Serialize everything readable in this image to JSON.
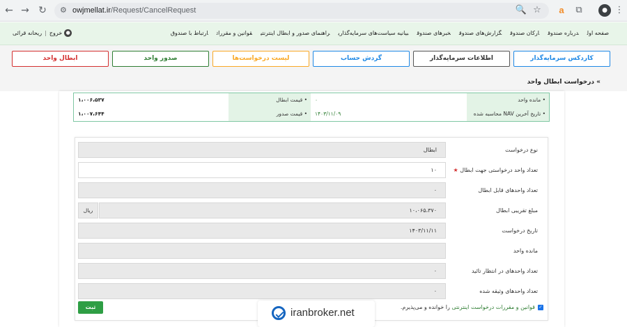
{
  "browser": {
    "url_host": "owjmellat.ir",
    "url_path": "/Request/CancelRequest"
  },
  "header": {
    "menu": [
      "صفحه اول",
      "درباره صندوق",
      "ارکان صندوق",
      "گزارش‌های صندوق",
      "خبرهای صندوق",
      "بیانیه سیاست‌های سرمایه‌گذاری",
      "راهنمای صدور و ابطال اینترنتی",
      "قوانین و مقررات",
      "ارتباط با صندوق"
    ],
    "user_name": "ریحانه قرائی",
    "logout": "خروج"
  },
  "tabs": {
    "cardex": "کاردکس سرمایه‌گذار",
    "investor_info": "اطلاعات سرمایه‌گذار",
    "account_turnover": "گردش حساب",
    "request_list": "لیست درخواست‌ها",
    "issue": "صدور واحد",
    "cancel": "ابطال واحد"
  },
  "breadcrumb": "درخواست ابطال واحد",
  "summary": {
    "remaining_label": "مانده واحد",
    "remaining_value": "۰",
    "cancel_price_label": "قیمت ابطال",
    "cancel_price_value": "۱،۰۰۶،۵۳۷",
    "nav_date_label": "تاریخ آخرین NAV محاسبه شده",
    "nav_date_value": "۱۴۰۳/۱۱/۰۹",
    "issue_price_label": "قیمت صدور",
    "issue_price_value": "۱،۰۰۷،۶۴۴"
  },
  "form": {
    "request_type_label": "نوع درخواست",
    "request_type_value": "ابطال",
    "units_requested_label": "تعداد واحد درخواستی جهت ابطال",
    "units_requested_value": "۱۰",
    "units_cancellable_label": "تعداد واحدهای قابل ابطال",
    "units_cancellable_value": "۰",
    "approx_amount_label": "مبلغ تقریبی ابطال",
    "approx_amount_value": "۱۰،۰۶۵،۳۷۰",
    "currency_unit": "ریال",
    "request_date_label": "تاریخ درخواست",
    "request_date_value": "۱۴۰۳/۱۱/۱۱",
    "remaining_units_label": "مانده واحد",
    "remaining_units_value": "",
    "pending_units_label": "تعداد واحدهای در انتظار تائید",
    "pending_units_value": "۰",
    "pledged_units_label": "تعداد واحدهای وثیقه شده",
    "pledged_units_value": "۰",
    "agree_link": "قوانین و مقررات درخواست اینترنتی",
    "agree_rest": "را خوانده و می‌پذیرم.",
    "submit_label": "ثبت"
  },
  "watermark": "iranbroker.net",
  "colors": {
    "cardex": "#1e88e5",
    "investor_info": "#555555",
    "account_turnover": "#1e88e5",
    "request_list": "#f9a825",
    "issue": "#2e7d32",
    "cancel": "#d32f2f"
  }
}
